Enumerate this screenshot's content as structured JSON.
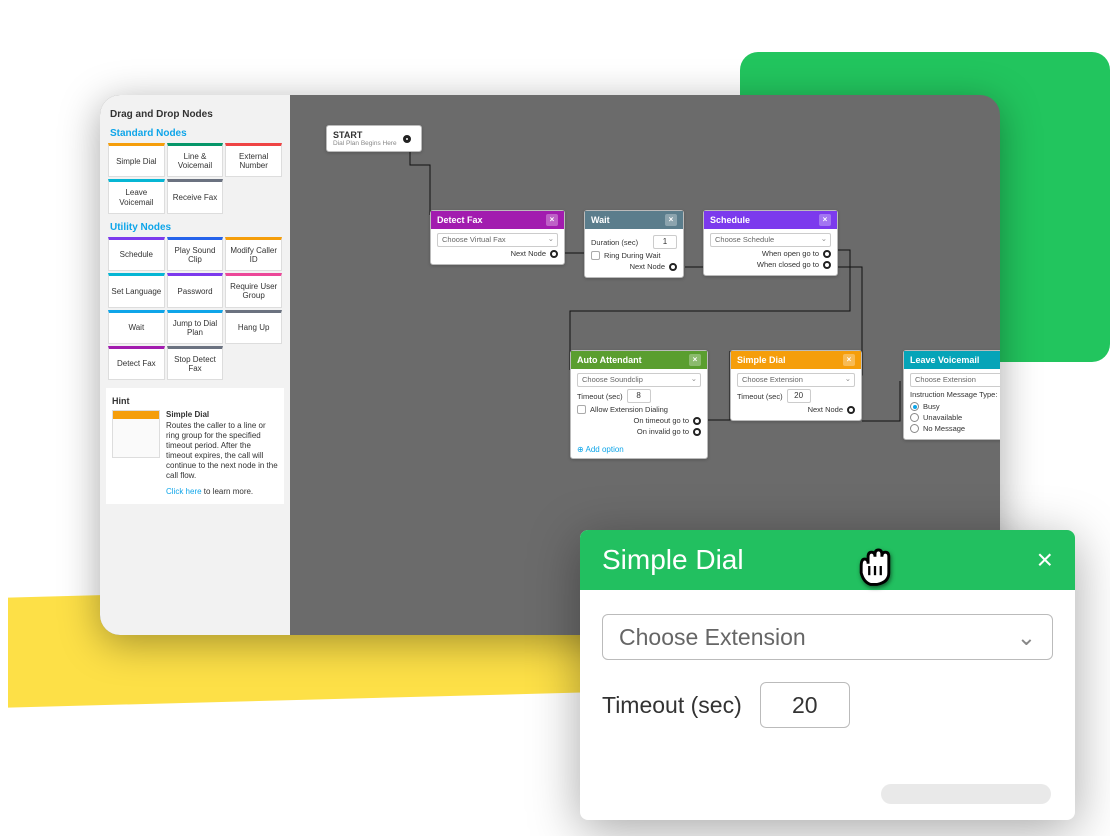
{
  "sidebar": {
    "title": "Drag and Drop Nodes",
    "standard_label": "Standard Nodes",
    "utility_label": "Utility Nodes",
    "standard": [
      {
        "label": "Simple Dial",
        "color": "#f59e0b"
      },
      {
        "label": "Line & Voicemail",
        "color": "#059669"
      },
      {
        "label": "External Number",
        "color": "#ef4444"
      },
      {
        "label": "Leave Voicemail",
        "color": "#06b6d4"
      },
      {
        "label": "Receive Fax",
        "color": "#6b7280"
      }
    ],
    "utility": [
      {
        "label": "Schedule",
        "color": "#7c3aed"
      },
      {
        "label": "Play Sound Clip",
        "color": "#2563eb"
      },
      {
        "label": "Modify Caller ID",
        "color": "#f59e0b"
      },
      {
        "label": "Set Language",
        "color": "#06b6d4"
      },
      {
        "label": "Password",
        "color": "#7c3aed"
      },
      {
        "label": "Require User Group",
        "color": "#ec4899"
      },
      {
        "label": "Wait",
        "color": "#0ea5e9"
      },
      {
        "label": "Jump to Dial Plan",
        "color": "#0ea5e9"
      },
      {
        "label": "Hang Up",
        "color": "#6b7280"
      },
      {
        "label": "Detect Fax",
        "color": "#a21caf"
      },
      {
        "label": "Stop Detect Fax",
        "color": "#6b7280"
      }
    ],
    "hint": {
      "heading": "Hint",
      "title": "Simple Dial",
      "body": "Routes the caller to a line or ring group for the specified timeout period. After the timeout expires, the call will continue to the next node in the call flow.",
      "link": "Click here",
      "link_tail": " to learn more."
    }
  },
  "canvas": {
    "start": {
      "title": "START",
      "sub": "Dial Plan Begins Here"
    },
    "detect_fax": {
      "title": "Detect Fax",
      "select": "Choose Virtual Fax",
      "next": "Next Node"
    },
    "wait": {
      "title": "Wait",
      "dur_lab": "Duration (sec)",
      "dur_val": "1",
      "ring_lab": "Ring During Wait",
      "next": "Next Node"
    },
    "schedule": {
      "title": "Schedule",
      "select": "Choose Schedule",
      "open": "When open go to",
      "closed": "When closed go to"
    },
    "auto_attendant": {
      "title": "Auto Attendant",
      "select": "Choose Soundclip",
      "timeout_lab": "Timeout (sec)",
      "timeout_val": "8",
      "allow_lab": "Allow Extension Dialing",
      "on_timeout": "On timeout go to",
      "on_invalid": "On invalid go to",
      "add": "Add option"
    },
    "simple_dial": {
      "title": "Simple Dial",
      "select": "Choose Extension",
      "timeout_lab": "Timeout (sec)",
      "timeout_val": "20",
      "next": "Next Node"
    },
    "leave_vm": {
      "title": "Leave Voicemail",
      "select": "Choose Extension",
      "msg_type": "Instruction Message Type:",
      "opts": [
        "Busy",
        "Unavailable",
        "No Message"
      ],
      "sel_idx": 0
    }
  },
  "modal": {
    "title": "Simple Dial",
    "select": "Choose Extension",
    "timeout_lab": "Timeout (sec)",
    "timeout_val": "20"
  },
  "colors": {
    "detect_fax": "#a21caf",
    "wait": "#5b7d8c",
    "schedule": "#7c3aed",
    "auto_attendant": "#5a9e2f",
    "simple_dial": "#f59e0b",
    "leave_vm": "#06a4b8",
    "modal_head": "#22c060"
  }
}
